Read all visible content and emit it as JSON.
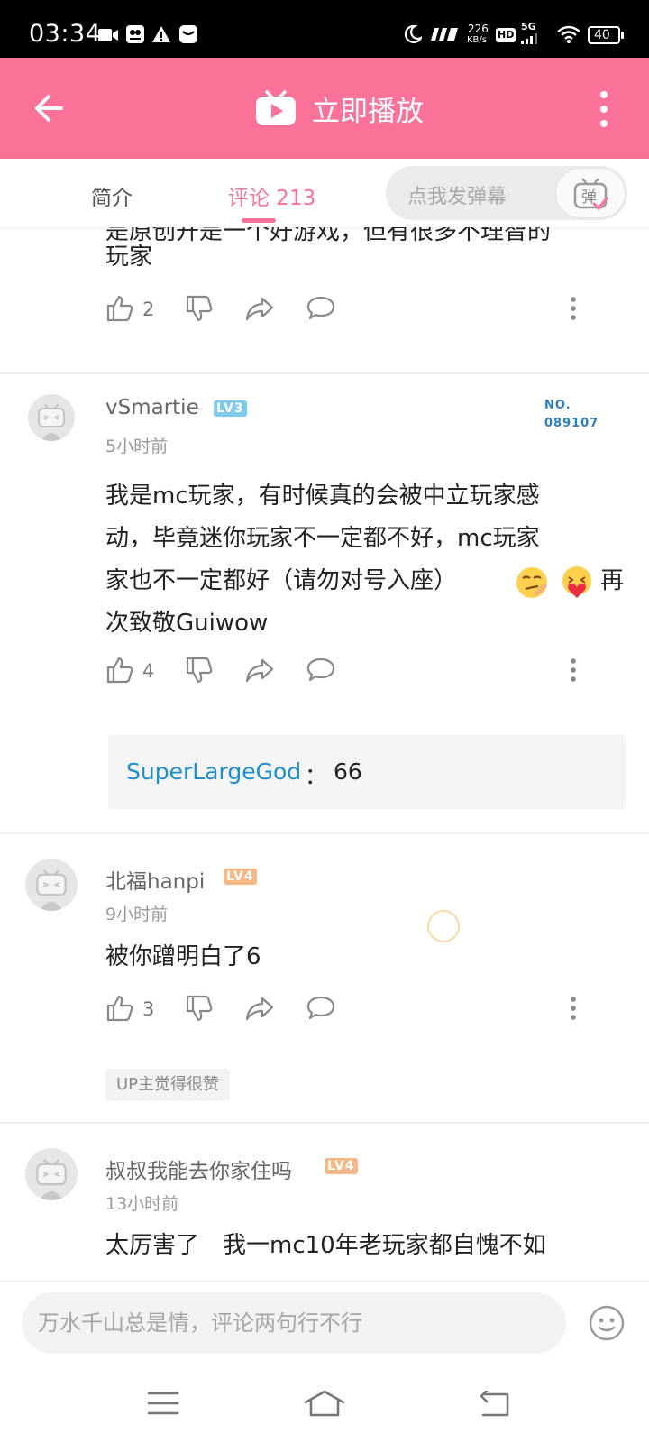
{
  "status_bar": {
    "time": "03:34",
    "net_speed_value": "226",
    "net_speed_unit": "KB/s",
    "hd_label": "HD",
    "signal_label": "5G",
    "battery": "40"
  },
  "app_bar": {
    "title": "立即播放",
    "icons": {
      "back": "arrow-left-icon",
      "play": "tv-play-icon",
      "more": "more-vertical-icon"
    },
    "accent_color": "#fb7299"
  },
  "tabs": {
    "intro_label": "简介",
    "comments_label": "评论 213",
    "danmaku_placeholder": "点我发弹幕",
    "danmaku_button_label": "弹"
  },
  "comments": {
    "partial": {
      "cut_text": "是原创开是一个好游戏，但有很多不理智的",
      "text_line": "玩家",
      "likes": "2"
    },
    "c1": {
      "username": "vSmartie",
      "level": "LV3",
      "time": "5小时前",
      "no_label": "NO.",
      "no_value": "089107",
      "lines": [
        "我是mc玩家，有时候真的会被中立玩家感",
        "动，毕竟迷你玩家不一定都不好，mc玩家",
        "家也不一定都好（请勿对号入座）",
        "次致敬Guiwow"
      ],
      "line3_tail": "再",
      "likes": "4",
      "reply_user": "SuperLargeGod",
      "reply_sep": "：",
      "reply_text": "66"
    },
    "c2": {
      "username": "北福hanpi",
      "level": "LV4",
      "time": "9小时前",
      "text": "被你蹭明白了6",
      "likes": "3",
      "badge": "UP主觉得很赞"
    },
    "c3": {
      "username": "叔叔我能去你家住吗",
      "level": "LV4",
      "time": "13小时前",
      "text": "太厉害了　我一mc10年老玩家都自愧不如"
    }
  },
  "input_bar": {
    "placeholder": "万水千山总是情，评论两句行不行"
  }
}
